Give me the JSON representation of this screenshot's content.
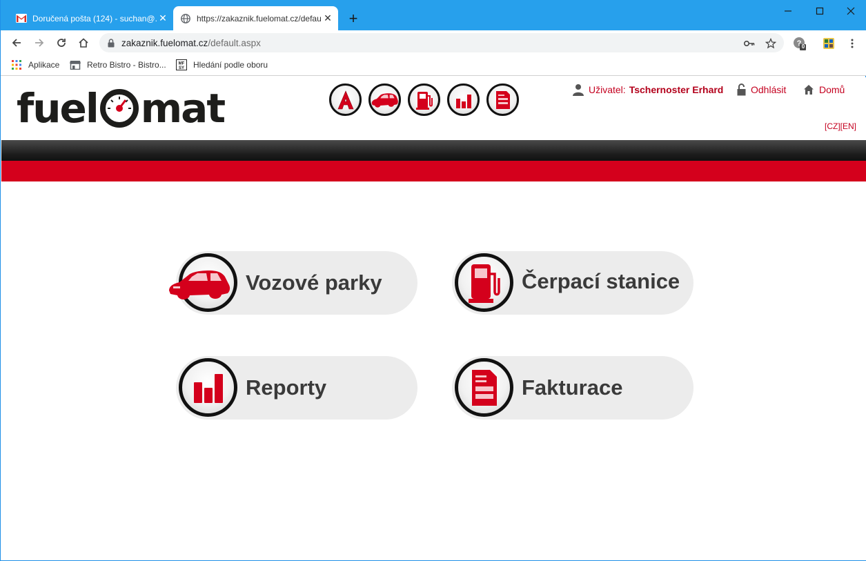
{
  "browser": {
    "tabs": [
      {
        "title": "Doručená pošta (124) - suchan@..."
      },
      {
        "title": "https://zakaznik.fuelomat.cz/default.aspx"
      }
    ],
    "url_host": "zakaznik.fuelomat.cz",
    "url_path": "/default.aspx",
    "extension_badge": "0",
    "bookmarks": [
      {
        "label": "Aplikace",
        "icon": "apps-grid-icon"
      },
      {
        "label": "Retro Bistro - Bistro...",
        "icon": "store-icon"
      },
      {
        "label": "Hledání podle oboru",
        "icon": "mf-logo-icon"
      }
    ]
  },
  "site": {
    "logo_left": "fuel",
    "logo_right": "mat",
    "user_label": "Uživatel:",
    "user_name": "Tschernoster Erhard",
    "logout_label": "Odhlásit",
    "home_label": "Domů",
    "lang_cz": "[CZ]",
    "lang_en": "[EN]",
    "top_icons": [
      "admin-a-icon",
      "car-icon",
      "fuel-pump-icon",
      "bar-chart-icon",
      "invoice-icon"
    ],
    "tiles": [
      {
        "label": "Vozové parky",
        "icon": "car-icon"
      },
      {
        "label": "Čerpací stanice",
        "icon": "fuel-pump-icon"
      },
      {
        "label": "Reporty",
        "icon": "bar-chart-icon"
      },
      {
        "label": "Fakturace",
        "icon": "invoice-icon"
      }
    ],
    "accent_color": "#d4001c"
  }
}
